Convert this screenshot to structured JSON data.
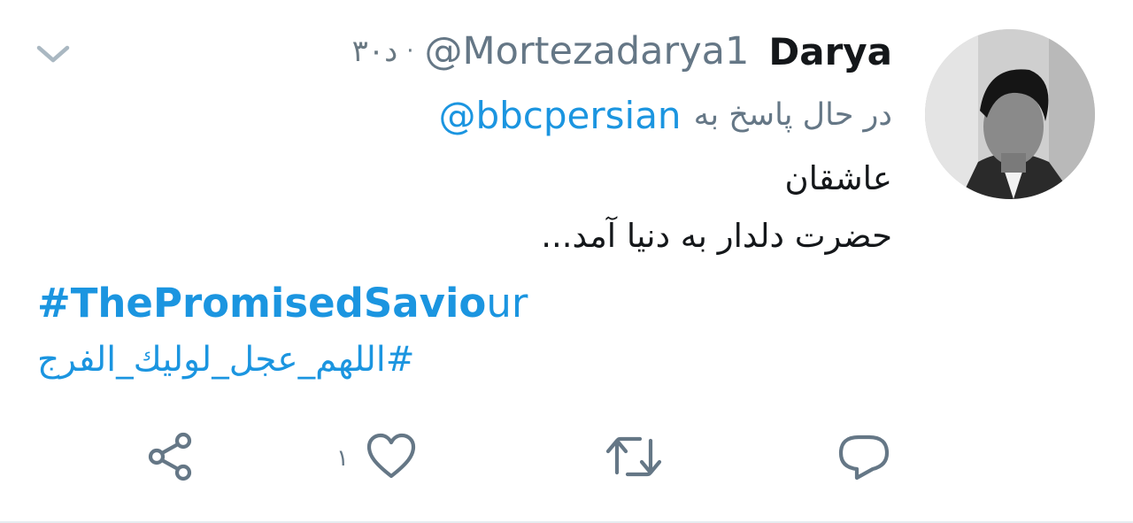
{
  "tweet": {
    "author_name": "Darya",
    "author_handle": "@Mortezadarya1",
    "time": "۳۰د",
    "separator": "·",
    "replying_label": "در حال پاسخ به",
    "replying_to": "@bbcpersian",
    "text_lines": [
      "عاشقان",
      "حضرت دلدار به دنیا آمد..."
    ],
    "hashtags": {
      "first_bold": "#ThePromisedSavio",
      "first_rest": "ur",
      "second": "#اللهم_عجل_لولیك_الفرج"
    }
  },
  "actions": {
    "like_count": "۱",
    "icons": [
      "share-icon",
      "like-icon",
      "retweet-icon",
      "reply-icon",
      "chevron-down-icon"
    ]
  },
  "colors": {
    "link": "#1b95e0",
    "secondary_text": "#657786",
    "primary_text": "#14171a",
    "icon": "#657786"
  }
}
